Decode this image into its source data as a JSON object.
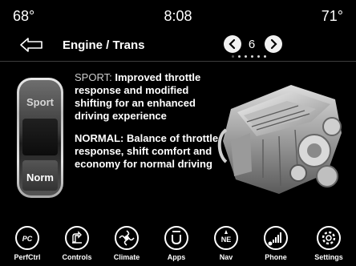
{
  "status": {
    "temp_left": "68°",
    "time": "8:08",
    "temp_right": "71°"
  },
  "header": {
    "back_icon": "back-arrow-icon",
    "title": "Engine / Trans",
    "page": "6",
    "page_dots": 6,
    "active_dot": 0
  },
  "switch": {
    "top_label": "Sport",
    "bottom_label": "Norm",
    "selected": "Norm"
  },
  "description": {
    "sport_mode": "SPORT:",
    "sport_text": "Improved throttle response and modified shifting for an enhanced driving experience",
    "normal_mode": "NORMAL:",
    "normal_text": "Balance of throttle response, shift comfort and economy for normal driving"
  },
  "nav": [
    {
      "label": "PerfCtrl",
      "icon": "perfctrl-icon"
    },
    {
      "label": "Controls",
      "icon": "controls-icon"
    },
    {
      "label": "Climate",
      "icon": "climate-icon"
    },
    {
      "label": "Apps",
      "icon": "apps-icon"
    },
    {
      "label": "Nav",
      "icon": "nav-compass-icon"
    },
    {
      "label": "Phone",
      "icon": "phone-icon"
    },
    {
      "label": "Settings",
      "icon": "settings-gear-icon"
    }
  ],
  "colors": {
    "background": "#000000",
    "text": "#ffffff",
    "accent": "#f2f2f2"
  }
}
